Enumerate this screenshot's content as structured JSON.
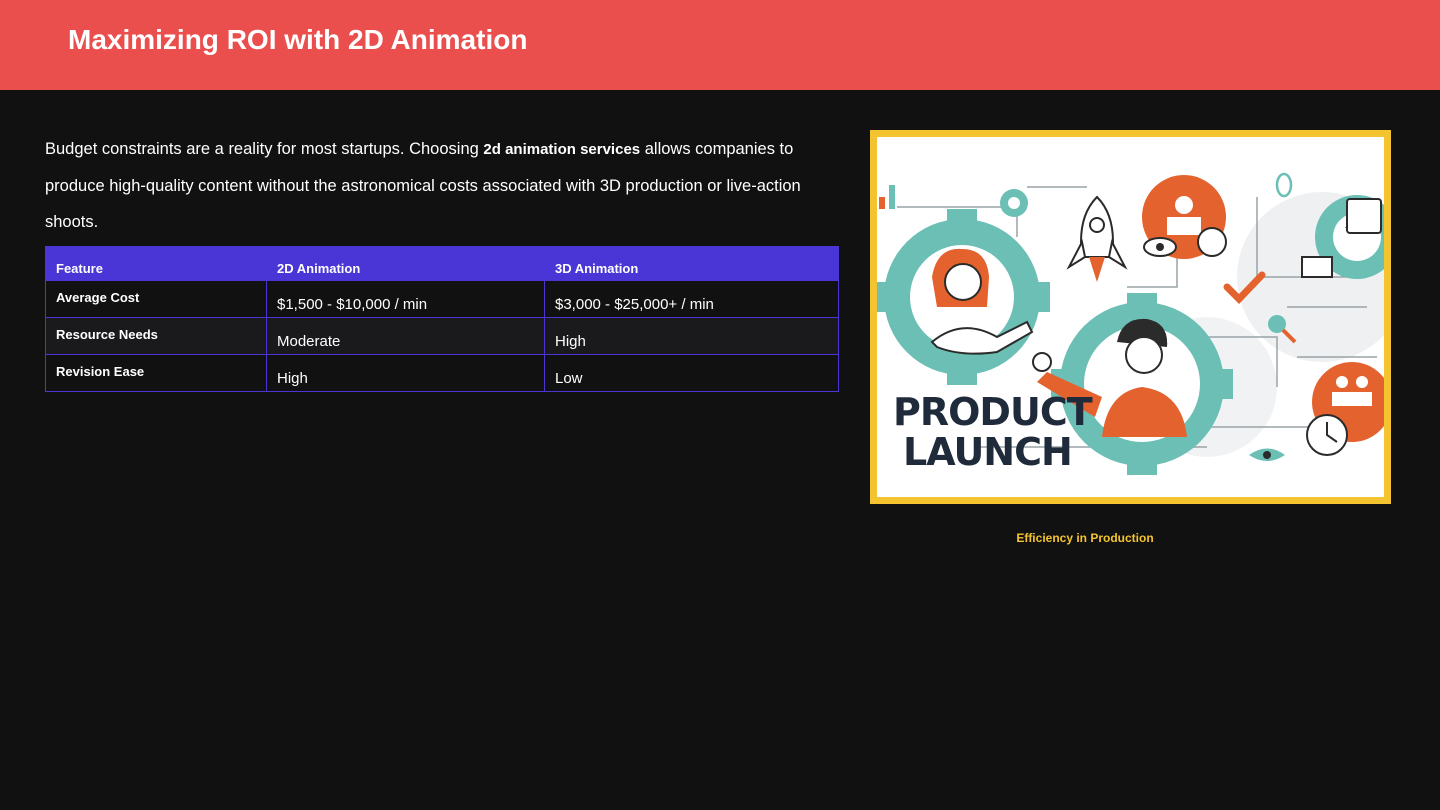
{
  "header": {
    "title": "Maximizing ROI with 2D Animation"
  },
  "intro": {
    "before": "Budget constraints are a reality for most startups. Choosing ",
    "bold": "2d animation services",
    "after": " allows companies to produce high-quality content without the astronomical costs associated with 3D production or live-action shoots."
  },
  "table": {
    "headers": [
      "Feature",
      "2D Animation",
      "3D Animation"
    ],
    "rows": [
      [
        "Average Cost",
        "$1,500 - $10,000 / min",
        "$3,000 - $25,000+ / min"
      ],
      [
        "Resource Needs",
        "Moderate",
        "High"
      ],
      [
        "Revision Ease",
        "High",
        "Low"
      ]
    ]
  },
  "image": {
    "text_line1": "PRODUCT",
    "text_line2": "LAUNCH",
    "caption": "Efficiency in Production"
  },
  "colors": {
    "header_bg": "#ea4f4e",
    "table_accent": "#4a35d6",
    "frame": "#f4c430",
    "teal": "#6bbfb5",
    "orange": "#e4622e"
  }
}
